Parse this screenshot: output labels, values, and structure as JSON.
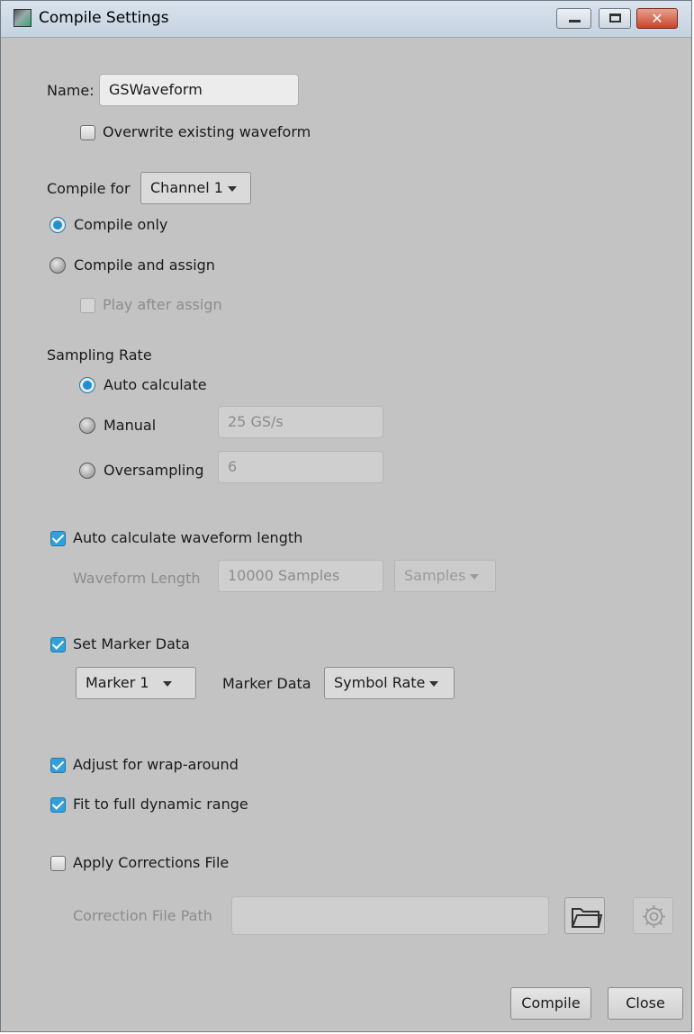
{
  "window": {
    "title": "Compile Settings",
    "icons": {
      "app": "app-icon",
      "minimize": "minimize-icon",
      "maximize": "maximize-icon",
      "close": "close-icon"
    },
    "close_glyph": "✕"
  },
  "name": {
    "label": "Name:",
    "value": "GSWaveform"
  },
  "overwrite": {
    "label": "Overwrite existing waveform",
    "checked": false
  },
  "compile_for": {
    "label": "Compile for",
    "selected": "Channel 1"
  },
  "compile_mode": {
    "compile_only": "Compile only",
    "compile_and_assign": "Compile and assign",
    "selected": "compile_only"
  },
  "play_after_assign": {
    "label": "Play after assign",
    "checked": false,
    "enabled": false
  },
  "sampling_rate": {
    "heading": "Sampling Rate",
    "auto_label": "Auto calculate",
    "manual_label": "Manual",
    "manual_value": "25 GS/s",
    "oversampling_label": "Oversampling",
    "oversampling_value": "6",
    "selected": "auto"
  },
  "waveform_length": {
    "auto_label": "Auto calculate waveform length",
    "checked": true,
    "length_label": "Waveform Length",
    "length_value": "10000 Samples",
    "unit": "Samples"
  },
  "marker": {
    "set_label": "Set Marker Data",
    "checked": true,
    "marker_selected": "Marker 1",
    "data_label": "Marker Data",
    "data_selected": "Symbol Rate"
  },
  "adjust_wrap": {
    "label": "Adjust for wrap-around",
    "checked": true
  },
  "fit_range": {
    "label": "Fit to full dynamic range",
    "checked": true
  },
  "corrections": {
    "apply_label": "Apply Corrections File",
    "checked": false,
    "path_label": "Correction File Path",
    "path_value": "",
    "browse_icon": "folder-icon",
    "settings_icon": "gear-icon"
  },
  "buttons": {
    "compile": "Compile",
    "close": "Close"
  },
  "colors": {
    "accent": "#33a0d9",
    "background": "#c3c3c3"
  }
}
